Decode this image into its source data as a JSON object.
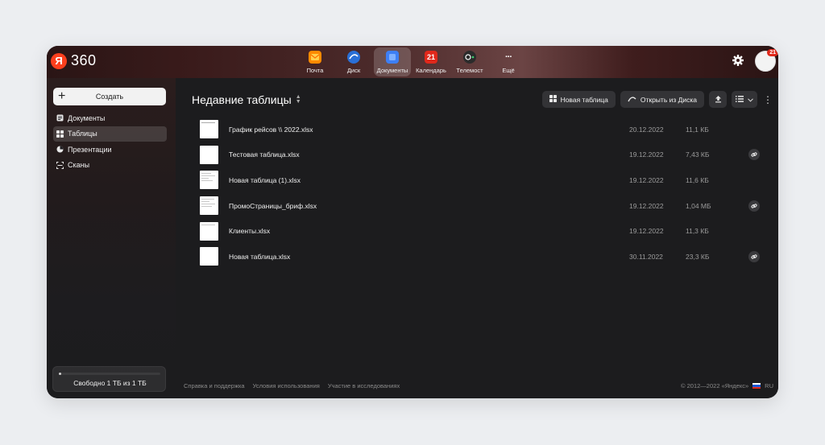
{
  "header": {
    "logo_letter": "Я",
    "logo_text": "360",
    "apps": [
      {
        "label": "Почта",
        "icon": "mail-icon",
        "color": "#ff8a00"
      },
      {
        "label": "Диск",
        "icon": "disk-icon",
        "color": "#2a6fd6"
      },
      {
        "label": "Документы",
        "icon": "documents-icon",
        "color": "#3d7ff5",
        "active": true
      },
      {
        "label": "Календарь",
        "icon": "calendar-icon",
        "color": "#e0281b",
        "badge": "21"
      },
      {
        "label": "Телемост",
        "icon": "telemost-icon",
        "color": "#2b2b2b"
      },
      {
        "label": "Ещё",
        "icon": "more-icon",
        "color": "transparent"
      }
    ],
    "avatar_badge": "21"
  },
  "sidebar": {
    "create_label": "Создать",
    "items": [
      {
        "label": "Документы",
        "icon": "document-icon"
      },
      {
        "label": "Таблицы",
        "icon": "table-icon",
        "active": true
      },
      {
        "label": "Презентации",
        "icon": "presentation-icon"
      },
      {
        "label": "Сканы",
        "icon": "scan-icon"
      }
    ],
    "storage": {
      "text": "Свободно 1 ТБ из 1 ТБ",
      "used_fraction": 0.01
    }
  },
  "main": {
    "title": "Недавние таблицы",
    "toolbar": {
      "new_table": "Новая таблица",
      "open_from_disk": "Открыть из Диска"
    },
    "files": [
      {
        "name": "График рейсов \\\\ 2022.xlsx",
        "date": "20.12.2022",
        "size": "11,1 КБ",
        "shared": false
      },
      {
        "name": "Тестовая таблица.xlsx",
        "date": "19.12.2022",
        "size": "7,43 КБ",
        "shared": true
      },
      {
        "name": "Новая таблица (1).xlsx",
        "date": "19.12.2022",
        "size": "11,6 КБ",
        "shared": false
      },
      {
        "name": "ПромоСтраницы_бриф.xlsx",
        "date": "19.12.2022",
        "size": "1,04 МБ",
        "shared": true
      },
      {
        "name": "Клиенты.xlsx",
        "date": "19.12.2022",
        "size": "11,3 КБ",
        "shared": false
      },
      {
        "name": "Новая таблица.xlsx",
        "date": "30.11.2022",
        "size": "23,3 КБ",
        "shared": true
      }
    ]
  },
  "footer": {
    "links": [
      "Справка и поддержка",
      "Условия использования",
      "Участие в исследованиях"
    ],
    "copyright": "© 2012—2022 «Яндекс»",
    "lang": "RU"
  }
}
